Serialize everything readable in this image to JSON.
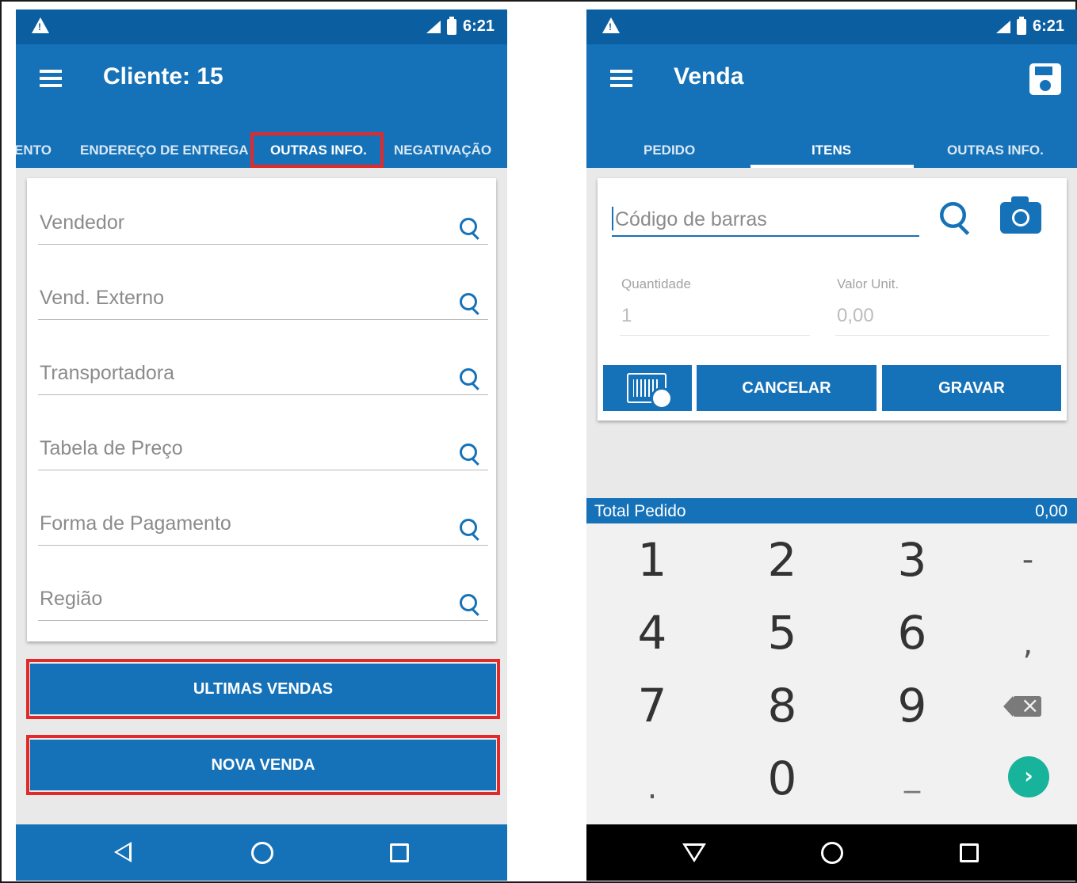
{
  "colors": {
    "primary": "#1672b8",
    "status_bar": "#0b5fa1",
    "highlight": "#e32a2a",
    "go": "#17b39a"
  },
  "left": {
    "status_time": "6:21",
    "title": "Cliente: 15",
    "tabs": [
      "ENTO",
      "ENDEREÇO DE ENTREGA",
      "OUTRAS INFO.",
      "NEGATIVAÇÃO"
    ],
    "fields": [
      "Vendedor",
      "Vend. Externo",
      "Transportadora",
      "Tabela de Preço",
      "Forma de Pagamento",
      "Região"
    ],
    "buttons": {
      "ultimas": "ULTIMAS VENDAS",
      "nova": "NOVA VENDA"
    }
  },
  "right": {
    "status_time": "6:21",
    "title": "Venda",
    "tabs": [
      "PEDIDO",
      "ITENS",
      "OUTRAS INFO."
    ],
    "barcode_placeholder": "Código de barras",
    "quantidade": {
      "label": "Quantidade",
      "value": "1"
    },
    "valor_unit": {
      "label": "Valor Unit.",
      "value": "0,00"
    },
    "buttons": {
      "cancelar": "CANCELAR",
      "gravar": "GRAVAR"
    },
    "total": {
      "label": "Total Pedido",
      "value": "0,00"
    },
    "keys": [
      "1",
      "2",
      "3",
      "-",
      "4",
      "5",
      "6",
      ",",
      "7",
      "8",
      "9",
      ".",
      "0",
      "_"
    ]
  }
}
